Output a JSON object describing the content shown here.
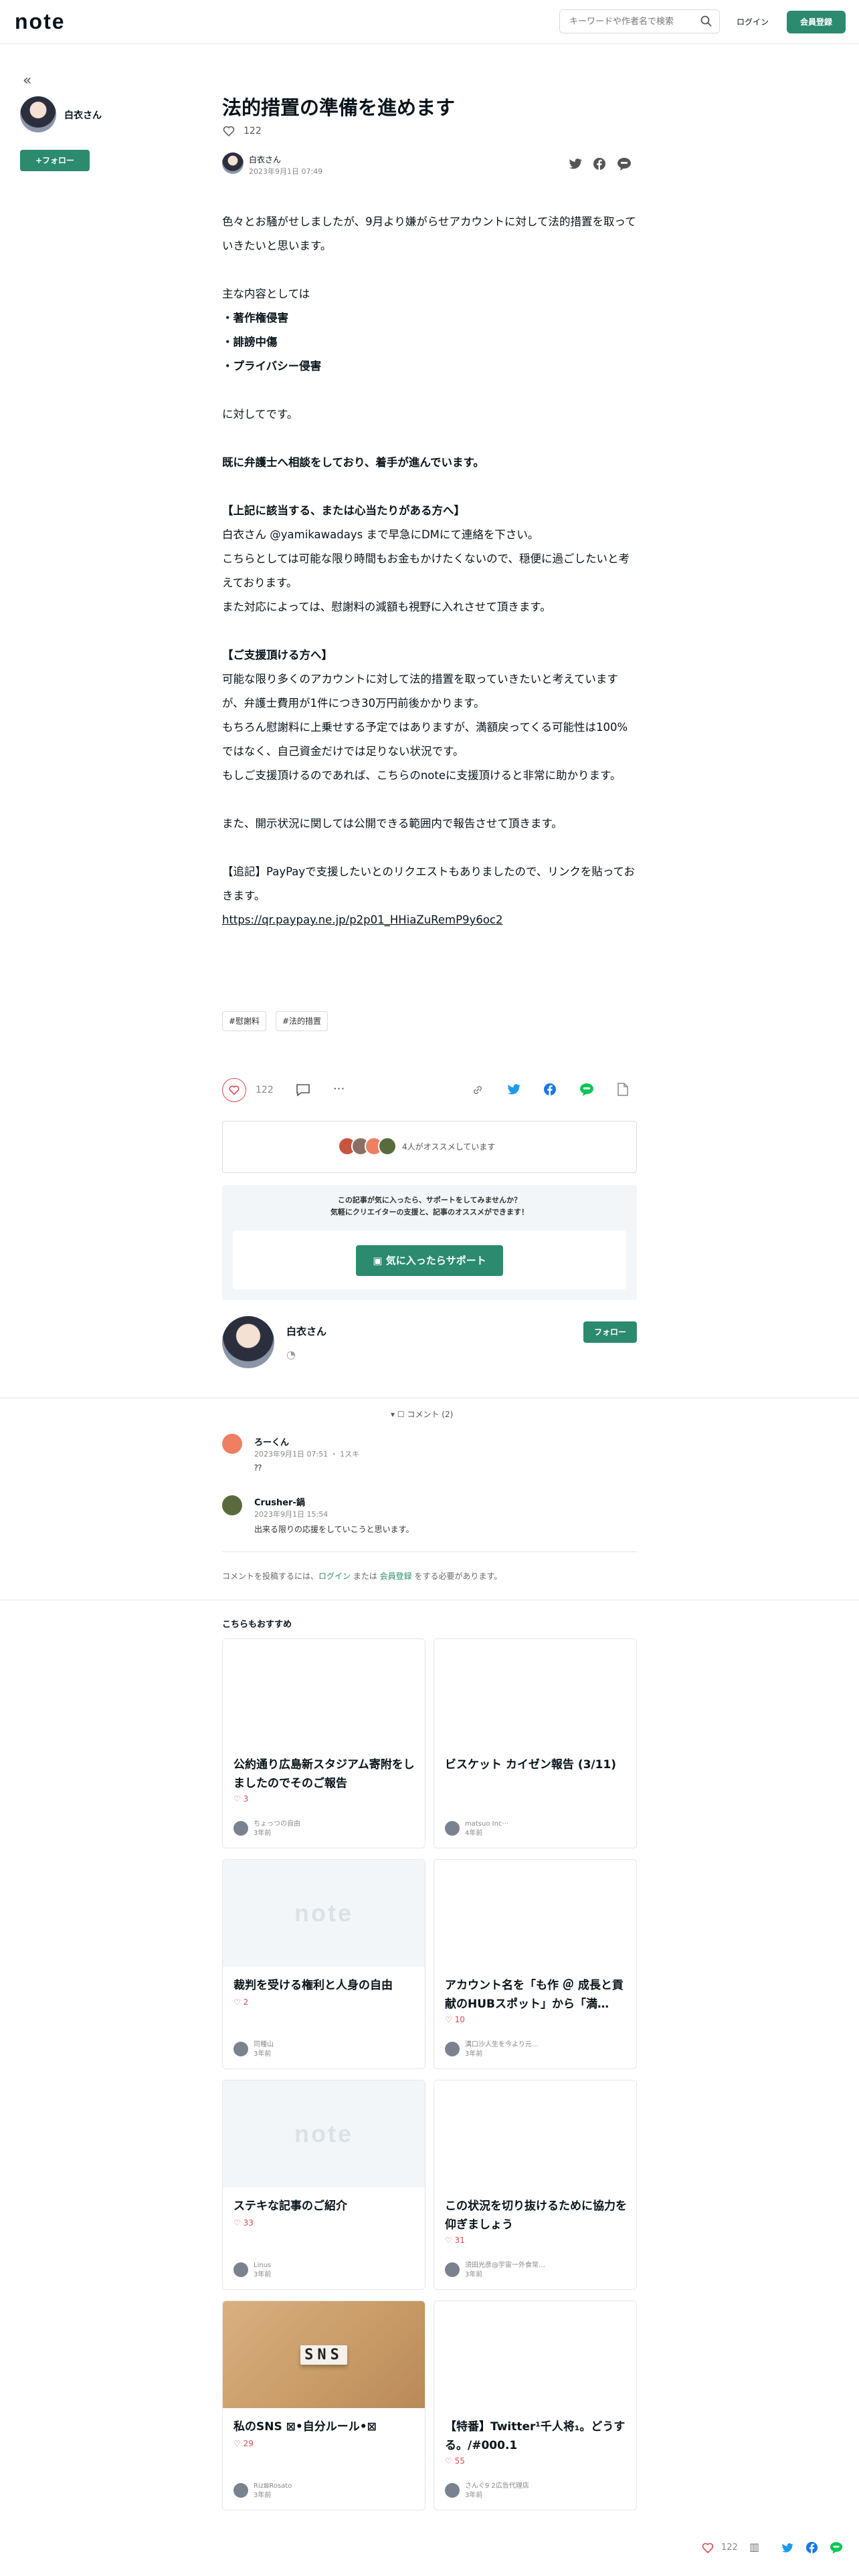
{
  "header": {
    "logo": "note",
    "search_placeholder": "キーワードや作者名で検索",
    "login": "ログイン",
    "register": "会員登録"
  },
  "sidebar": {
    "author_name": "白衣さん",
    "follow": "+フォロー"
  },
  "article": {
    "title": "法的措置の準備を進めます",
    "like_count": "122",
    "author_name": "白衣さん",
    "date": "2023年9月1日 07:49",
    "paragraphs": [
      {
        "t": "色々とお騒がせしましたが、9月より嫌がらせアカウントに対して法的措置を取っていきたいと思います。",
        "b": false
      },
      {
        "t": "",
        "b": false
      },
      {
        "t": "主な内容としては",
        "b": false
      },
      {
        "t": "・著作権侵害",
        "b": true
      },
      {
        "t": "・誹謗中傷",
        "b": true
      },
      {
        "t": "・プライバシー侵害",
        "b": true
      },
      {
        "t": "",
        "b": false
      },
      {
        "t": "に対してです。",
        "b": false
      },
      {
        "t": "",
        "b": false
      },
      {
        "t": "既に弁護士へ相談をしており、着手が進んでいます。",
        "b": true
      },
      {
        "t": "",
        "b": false
      },
      {
        "t": "【上記に該当する、または心当たりがある方へ】",
        "b": true
      },
      {
        "t": "白衣さん @yamikawadays まで早急にDMにて連絡を下さい。",
        "b": false
      },
      {
        "t": "こちらとしては可能な限り時間もお金もかけたくないので、穏便に過ごしたいと考えております。",
        "b": false
      },
      {
        "t": "また対応によっては、慰謝料の減額も視野に入れさせて頂きます。",
        "b": false
      },
      {
        "t": "",
        "b": false
      },
      {
        "t": "【ご支援頂ける方へ】",
        "b": true
      },
      {
        "t": "可能な限り多くのアカウントに対して法的措置を取っていきたいと考えていますが、弁護士費用が1件につき30万円前後かかります。",
        "b": false
      },
      {
        "t": "もちろん慰謝料に上乗せする予定ではありますが、満額戻ってくる可能性は100%ではなく、自己資金だけでは足りない状況です。",
        "b": false
      },
      {
        "t": "もしご支援頂けるのであれば、こちらのnoteに支援頂けると非常に助かります。",
        "b": false
      },
      {
        "t": "",
        "b": false
      },
      {
        "t": "また、開示状況に関しては公開できる範囲内で報告させて頂きます。",
        "b": false
      },
      {
        "t": "",
        "b": false
      },
      {
        "t": "【追記】PayPayで支援したいとのリクエストもありましたので、リンクを貼っておきます。",
        "b": false
      },
      {
        "t": "https://qr.paypay.ne.jp/p2p01_HHiaZuRemP9y6oc2",
        "b": false,
        "link": true
      }
    ],
    "tags": [
      "#慰謝料",
      "#法的措置"
    ],
    "action_like_count": "122",
    "recommend_text": "4人がオススメしています"
  },
  "support": {
    "line1": "この記事が気に入ったら、サポートをしてみませんか？",
    "line2": "気軽にクリエイターの支援と、記事のオススメができます！",
    "button": "気に入ったらサポート"
  },
  "author_box": {
    "name": "白衣さん",
    "follow": "フォロー"
  },
  "comments": {
    "toggle": "コメント (2)",
    "items": [
      {
        "name": "ろーくん",
        "meta": "2023年9月1日 07:51 ・ 1スキ",
        "text": "⁇"
      },
      {
        "name": "Crusher-鍋",
        "meta": "2023年9月1日 15:54",
        "text": "出来る限りの応援をしていこうと思います。"
      }
    ],
    "login_prefix": "コメントを投稿するには、",
    "login_link": "ログイン",
    "login_mid": " または ",
    "register_link": "会員登録",
    "login_suffix": " をする必要があります。"
  },
  "recommend": {
    "heading": "こちらもおすすめ",
    "cards": [
      {
        "title": "公約通り広島新スタジアム寄附をしましたのでそのご報告",
        "likes": "3",
        "author": "ちょっつの自由",
        "time": "3年前",
        "thumb": "none"
      },
      {
        "title": "ビスケット カイゼン報告 (3/11)",
        "likes": "",
        "author": "matsuo Inc···",
        "time": "4年前",
        "thumb": "none"
      },
      {
        "title": "裁判を受ける権利と人身の自由",
        "likes": "2",
        "author": "同種山",
        "time": "3年前",
        "thumb": "note"
      },
      {
        "title": "アカウント名を「も作 ＠ 成長と貢献のHUBスポット」から「満…",
        "likes": "10",
        "author": "溝口沙人生を今より元…",
        "time": "3年前",
        "thumb": "none"
      },
      {
        "title": "ステキな記事のご紹介",
        "likes": "33",
        "author": "Linus",
        "time": "3年前",
        "thumb": "note"
      },
      {
        "title": "この状況を切り抜けるために協力を仰ぎましょう",
        "likes": "31",
        "author": "須田光彦@宇宙一外食常…",
        "time": "3年前",
        "thumb": "none"
      },
      {
        "title": "私のSNS ⊠•自分ルール•⊠",
        "likes": "29",
        "author": "Riz⊠Rosato",
        "time": "3年前",
        "thumb": "sns"
      },
      {
        "title": "【特番】Twitter¹千人将₁。どうする。/#000.1",
        "likes": "55",
        "author": "さんぐ9 2広告代理店",
        "time": "3年前",
        "thumb": "none"
      }
    ],
    "thumb_logo": "note",
    "sns_word": "SNS"
  },
  "footer_bar": {
    "like_count": "122"
  },
  "colors": {
    "brand_green": "#2c8a6e",
    "like_red": "#e5484d",
    "twitter": "#1d9bf0",
    "facebook": "#1877f2",
    "line": "#06c755"
  }
}
